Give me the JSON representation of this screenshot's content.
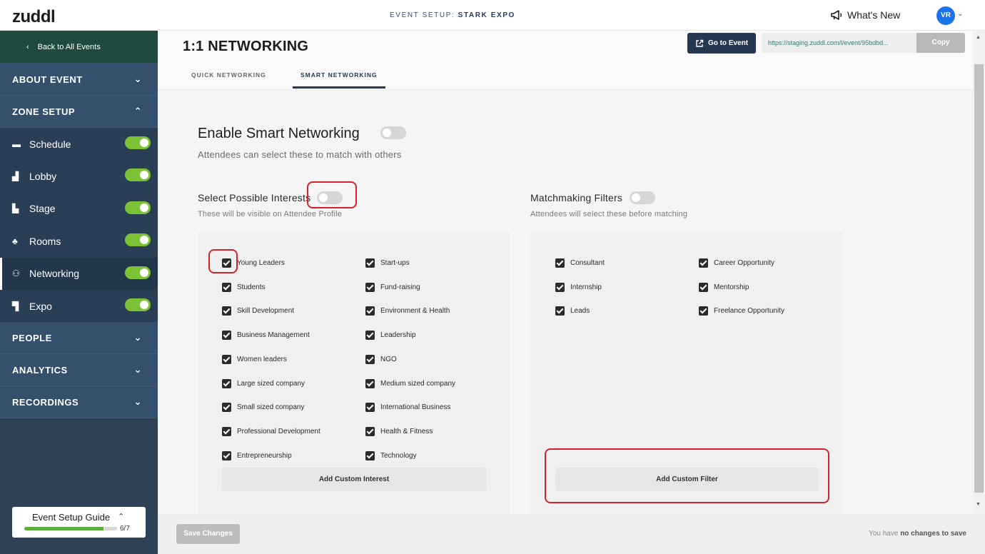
{
  "app": {
    "logo": "zuddl"
  },
  "topbar": {
    "event_prefix": "EVENT SETUP: ",
    "event_name": "STARK EXPO",
    "whats_new": "What's New",
    "avatar_initials": "VR"
  },
  "sidebar": {
    "back_label": "Back to All Events",
    "sections": {
      "about": "ABOUT EVENT",
      "zone": "ZONE SETUP",
      "people": "PEOPLE",
      "analytics": "ANALYTICS",
      "recordings": "RECORDINGS"
    },
    "zone_items": [
      {
        "label": "Schedule",
        "enabled": true
      },
      {
        "label": "Lobby",
        "enabled": true
      },
      {
        "label": "Stage",
        "enabled": true
      },
      {
        "label": "Rooms",
        "enabled": true
      },
      {
        "label": "Networking",
        "enabled": true
      },
      {
        "label": "Expo",
        "enabled": true
      }
    ],
    "guide": {
      "title": "Event Setup Guide",
      "count": "6/7",
      "progress": 0.857
    }
  },
  "header": {
    "title": "1:1 NETWORKING",
    "go_to_event": "Go to Event",
    "url": "https://staging.zuddl.com/l/event/95bdbd...",
    "copy": "Copy",
    "tabs": [
      "QUICK NETWORKING",
      "SMART NETWORKING"
    ],
    "active_tab": "SMART NETWORKING"
  },
  "smart": {
    "enable_title": "Enable Smart Networking",
    "enable_desc": "Attendees can select these to match with others",
    "enabled": false
  },
  "interests": {
    "title": "Select Possible Interests",
    "desc": "These will be visible on Attendee Profile",
    "enabled": false,
    "left": [
      "Young Leaders",
      "Students",
      "Skill Development",
      "Business Management",
      "Women leaders",
      "Large sized company",
      "Small sized company",
      "Professional Development",
      "Entrepreneurship"
    ],
    "right": [
      "Start-ups",
      "Fund-raising",
      "Environment & Health",
      "Leadership",
      "NGO",
      "Medium sized company",
      "International Business",
      "Health & Fitness",
      "Technology"
    ],
    "add_button": "Add Custom Interest"
  },
  "filters": {
    "title": "Matchmaking Filters",
    "desc": "Attendees will select these before matching",
    "enabled": false,
    "left": [
      "Consultant",
      "Internship",
      "Leads"
    ],
    "right": [
      "Career Opportunity",
      "Mentorship",
      "Freelance Opportunity"
    ],
    "add_button": "Add Custom Filter"
  },
  "footer": {
    "save": "Save Changes",
    "status_prefix": "You have ",
    "status_bold": "no changes to save"
  },
  "colors": {
    "sidebar_bg": "#2e4157",
    "accent_green": "#7cc235",
    "primary_dark": "#25384f",
    "highlight_red": "#d6232a"
  }
}
